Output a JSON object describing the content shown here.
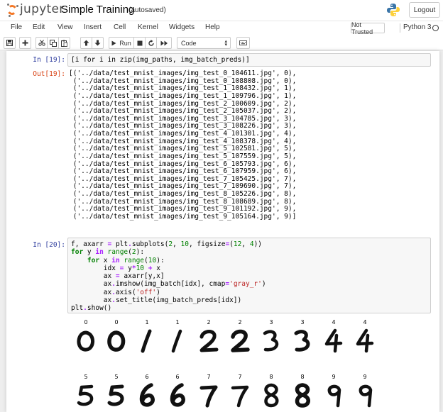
{
  "header": {
    "logo_text": "jupyter",
    "notebook_title": "Simple Training",
    "save_status": "(autosaved)",
    "logout_label": "Logout",
    "logo_icon": "jupyter-logo-icon",
    "python_icon": "python-logo-icon"
  },
  "menu": {
    "items": [
      "File",
      "Edit",
      "View",
      "Insert",
      "Cell",
      "Kernel",
      "Widgets",
      "Help"
    ],
    "trust_label": "Not Trusted",
    "kernel_name": "Python 3"
  },
  "toolbar": {
    "run_label": "Run",
    "cell_type": "Code",
    "icons": [
      "save-icon",
      "add-cell-icon",
      "cut-icon",
      "copy-icon",
      "paste-icon",
      "move-up-icon",
      "move-down-icon",
      "run-icon",
      "stop-icon",
      "restart-icon",
      "fast-forward-icon",
      "keyboard-icon"
    ]
  },
  "cells": [
    {
      "in_prompt": "In [19]:",
      "code": "[i for i in zip(img_paths, img_batch_preds)]",
      "out_prompt": "Out[19]:",
      "output_lines": [
        "[('../data/test_mnist_images/img_test_0_104611.jpg', 0),",
        " ('../data/test_mnist_images/img_test_0_108808.jpg', 0),",
        " ('../data/test_mnist_images/img_test_1_108432.jpg', 1),",
        " ('../data/test_mnist_images/img_test_1_109796.jpg', 1),",
        " ('../data/test_mnist_images/img_test_2_100609.jpg', 2),",
        " ('../data/test_mnist_images/img_test_2_105037.jpg', 2),",
        " ('../data/test_mnist_images/img_test_3_104785.jpg', 3),",
        " ('../data/test_mnist_images/img_test_3_108226.jpg', 3),",
        " ('../data/test_mnist_images/img_test_4_101301.jpg', 4),",
        " ('../data/test_mnist_images/img_test_4_108378.jpg', 4),",
        " ('../data/test_mnist_images/img_test_5_102581.jpg', 5),",
        " ('../data/test_mnist_images/img_test_5_107559.jpg', 5),",
        " ('../data/test_mnist_images/img_test_6_105793.jpg', 6),",
        " ('../data/test_mnist_images/img_test_6_107959.jpg', 6),",
        " ('../data/test_mnist_images/img_test_7_105425.jpg', 7),",
        " ('../data/test_mnist_images/img_test_7_109690.jpg', 7),",
        " ('../data/test_mnist_images/img_test_8_105226.jpg', 8),",
        " ('../data/test_mnist_images/img_test_8_108689.jpg', 8),",
        " ('../data/test_mnist_images/img_test_9_101192.jpg', 9),",
        " ('../data/test_mnist_images/img_test_9_105164.jpg', 9)]"
      ]
    },
    {
      "in_prompt": "In [20]:",
      "code_lines": [
        "f, axarr = plt.subplots(2, 10, figsize=(12, 4))",
        "for y in range(2):",
        "    for x in range(10):",
        "        idx = y*10 + x",
        "        ax = axarr[y,x]",
        "        ax.imshow(img_batch[idx], cmap='gray_r')",
        "        ax.axis('off')",
        "        ax.set_title(img_batch_preds[idx])",
        "plt.show()"
      ]
    }
  ],
  "digit_grid": {
    "row1_titles": [
      "0",
      "0",
      "1",
      "1",
      "2",
      "2",
      "3",
      "3",
      "4",
      "4"
    ],
    "row2_titles": [
      "5",
      "5",
      "6",
      "6",
      "7",
      "7",
      "8",
      "8",
      "9",
      "9"
    ]
  }
}
